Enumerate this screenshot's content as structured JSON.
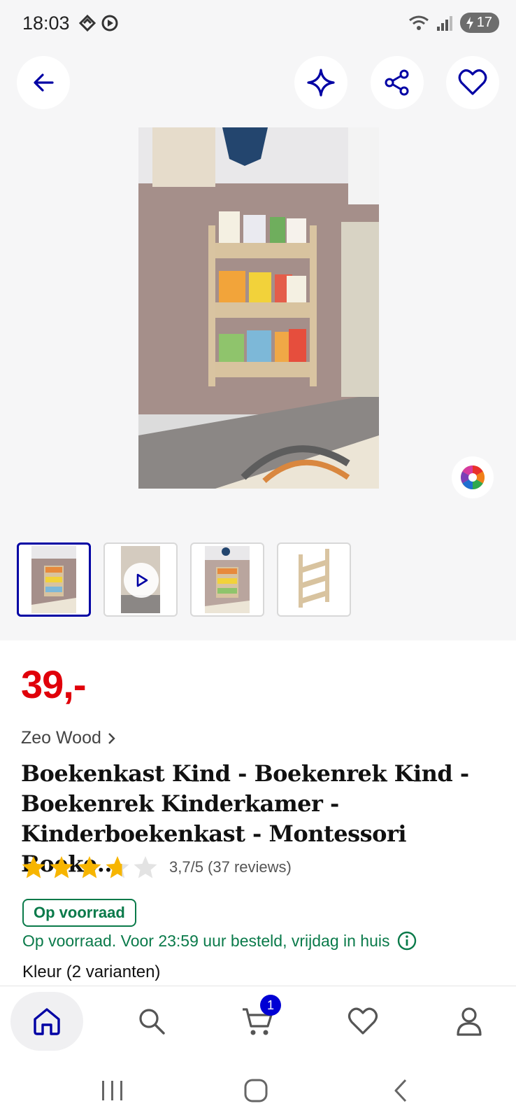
{
  "status_bar": {
    "time": "18:03",
    "battery": "17"
  },
  "header": {
    "back_icon": "arrow-left-icon",
    "actions": [
      "sparkle-icon",
      "share-icon",
      "heart-icon"
    ]
  },
  "gallery": {
    "thumbnail_count": 4,
    "selected_thumbnail": 1,
    "thumbnails": [
      "photo",
      "video",
      "photo",
      "product-only"
    ]
  },
  "product": {
    "price": "39,-",
    "brand": "Zeo Wood",
    "title": "Boekenkast Kind - Boekenrek Kind - Boekenrek Kinderkamer - Kinderboekenkast - Montessori Boeke...",
    "rating_value": 3.7,
    "rating_max": 5,
    "rating_text": "3,7/5 (37 reviews)",
    "stock_badge": "Op voorraad",
    "delivery": "Op voorraad. Voor 23:59 uur besteld, vrijdag in huis",
    "variants": "Kleur (2 varianten)"
  },
  "bottom_nav": {
    "items": [
      "home-icon",
      "search-icon",
      "cart-icon",
      "heart-icon",
      "account-icon"
    ],
    "active": "home-icon",
    "cart_count": "1"
  },
  "colors": {
    "brand_blue": "#0000a4",
    "price_red": "#e0000a",
    "stock_green": "#0a7a4a"
  }
}
